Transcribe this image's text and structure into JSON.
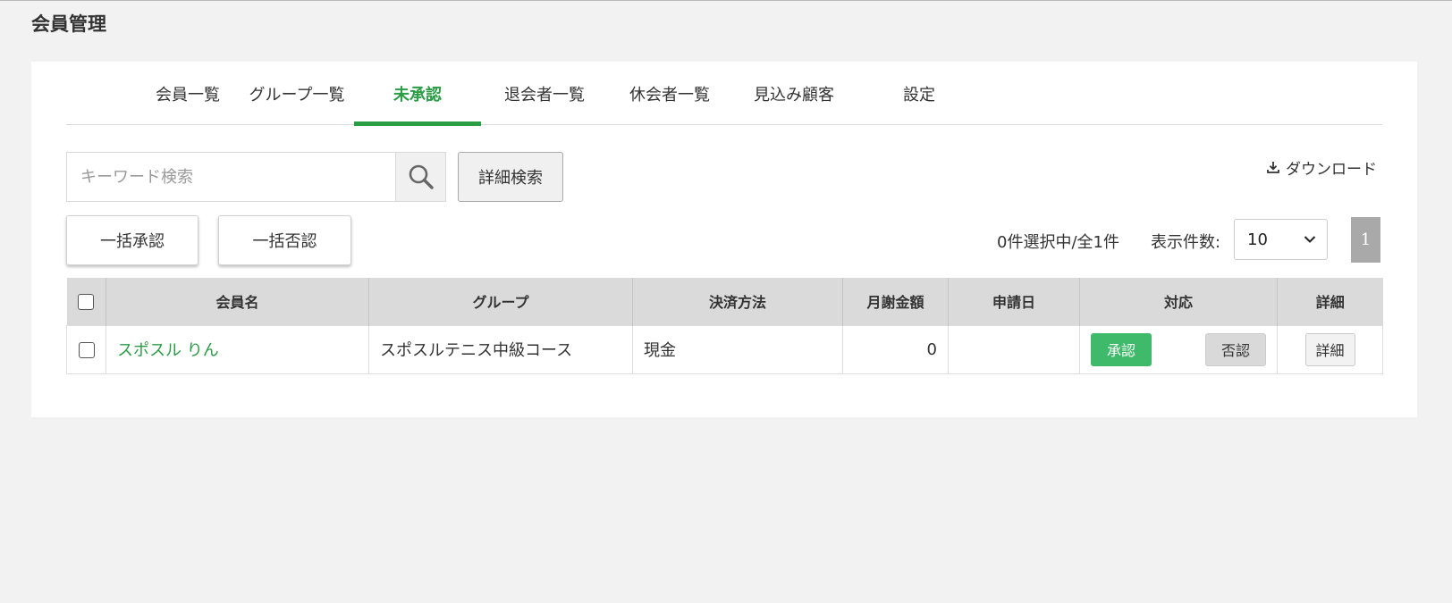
{
  "page": {
    "title": "会員管理"
  },
  "tabs": [
    {
      "label": "会員一覧",
      "active": false
    },
    {
      "label": "グループ一覧",
      "active": false
    },
    {
      "label": "未承認",
      "active": true
    },
    {
      "label": "退会者一覧",
      "active": false
    },
    {
      "label": "休会者一覧",
      "active": false
    },
    {
      "label": "見込み顧客",
      "active": false
    },
    {
      "label": "設定",
      "active": false
    }
  ],
  "search": {
    "placeholder": "キーワード検索",
    "value": "",
    "icon": "search-icon"
  },
  "toolbar": {
    "detail_search_label": "詳細検索",
    "download_label": "ダウンロード",
    "download_icon": "download-icon",
    "bulk_approve_label": "一括承認",
    "bulk_reject_label": "一括否認",
    "selection_status": "0件選択中/全1件",
    "per_page_label": "表示件数:",
    "per_page_value": "10",
    "current_page": "1"
  },
  "table": {
    "headers": [
      "会員名",
      "グループ",
      "決済方法",
      "月謝金額",
      "申請日",
      "対応",
      "詳細"
    ],
    "rows": [
      {
        "member_name": "スポスル りん",
        "group": "スポスルテニス中級コース",
        "payment_method": "現金",
        "monthly_fee": "0",
        "application_date": "",
        "approve_label": "承認",
        "reject_label": "否認",
        "detail_label": "詳細"
      }
    ]
  },
  "colors": {
    "accent": "#2a9d45",
    "approve": "#3fba6a",
    "header_bg": "#dadada",
    "page_bg": "#f2f2f2"
  }
}
